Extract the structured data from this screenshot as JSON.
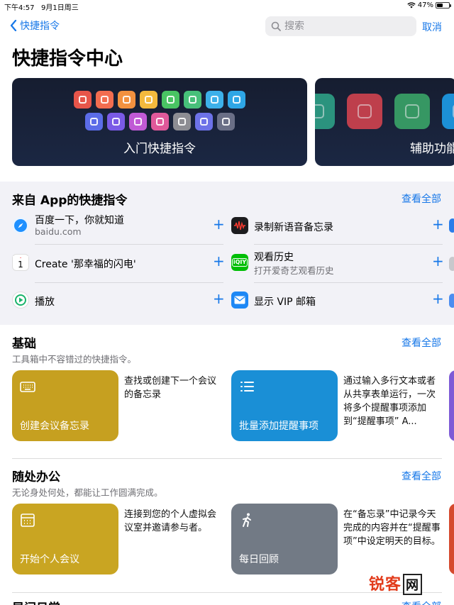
{
  "status": {
    "time": "下午4:57",
    "date": "9月1日周三",
    "battery": "47%",
    "battery_level": 0.47
  },
  "nav": {
    "back_label": "快捷指令",
    "search_placeholder": "搜索",
    "cancel_label": "取消"
  },
  "page_title": "快捷指令中心",
  "banners": [
    {
      "title": "入门快捷指令"
    },
    {
      "title": "辅助功能"
    }
  ],
  "apps_section": {
    "title": "来自 App的快捷指令",
    "see_all": "查看全部",
    "items": [
      {
        "title": "百度一下，你就知道",
        "subtitle": "baidu.com",
        "icon": "safari-icon",
        "color": "#1e90ff"
      },
      {
        "title": "录制新语音备忘录",
        "subtitle": "",
        "icon": "voice-memo-icon",
        "color": "#1c1c1e"
      },
      {
        "title": "Create '那幸福的闪电'",
        "subtitle": "",
        "icon": "calendar-icon",
        "color": "#ffffff",
        "day": "1"
      },
      {
        "title": "观看历史",
        "subtitle": "打开爱奇艺观看历史",
        "icon": "iqiyi-icon",
        "color": "#00be06"
      },
      {
        "title": "播放",
        "subtitle": "",
        "icon": "play-app-icon",
        "color": "#ffffff"
      },
      {
        "title": "显示 VIP 邮箱",
        "subtitle": "",
        "icon": "mail-icon",
        "color": "#1e88f5"
      }
    ]
  },
  "basics": {
    "title": "基础",
    "subtitle": "工具箱中不容错过的快捷指令。",
    "see_all": "查看全部",
    "cards": [
      {
        "label": "创建会议备忘录",
        "desc": "查找或创建下一个会议的备忘录",
        "icon": "keyboard-icon",
        "color": "#c6a020"
      },
      {
        "label": "批量添加提醒事项",
        "desc": "通过输入多行文本或者从共享表单运行，一次将多个提醒事项添加到“提醒事项” A...",
        "icon": "list-icon",
        "color": "#1a8fd6"
      }
    ]
  },
  "office": {
    "title": "随处办公",
    "subtitle": "无论身处何处，都能让工作圆满完成。",
    "see_all": "查看全部",
    "cards": [
      {
        "label": "开始个人会议",
        "desc": "连接到您的个人虚拟会议室并邀请参与者。",
        "icon": "calendar-grid-icon",
        "color": "#c9a522"
      },
      {
        "label": "每日回顾",
        "desc": "在“备忘录”中记录今天完成的内容并在“提醒事项”中设定明天的目标。",
        "icon": "walking-icon",
        "color": "#727a85"
      }
    ]
  },
  "next_section": {
    "title": "早间日常",
    "see_all": "查看全部"
  },
  "watermark": {
    "brand": "锐客",
    "suffix": "网"
  },
  "tile_colors": [
    "#e7554a",
    "#f26d50",
    "#f3913f",
    "#f3b93d",
    "#49c463",
    "#47c07a",
    "#3db0e9",
    "#2ea6e6",
    "#5b6ce8",
    "#7a5ae6",
    "#c05ad5",
    "#e0599a",
    "#8d8d93",
    "#6d72e8",
    "#6a6f86"
  ],
  "banner2_colors": [
    "#2ea086",
    "#d1434f",
    "#3aa468",
    "#1d9ce8"
  ]
}
